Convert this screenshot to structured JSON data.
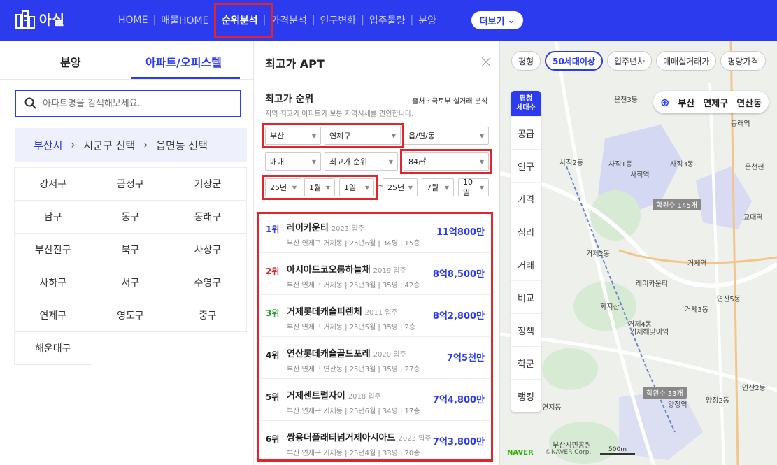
{
  "header": {
    "logo_text": "아실",
    "nav": [
      "HOME",
      "매물HOME",
      "순위분석",
      "가격분석",
      "인구변화",
      "입주물량",
      "분양"
    ],
    "active_index": 2,
    "more_label": "더보기"
  },
  "left": {
    "tabs": [
      "분양",
      "아파트/오피스텔"
    ],
    "active_tab": 1,
    "search_placeholder": "아파트명을 검색해보세요.",
    "breadcrumb": [
      "부산시",
      "시군구 선택",
      "읍면동 선택"
    ],
    "districts": [
      "강서구",
      "금정구",
      "기장군",
      "남구",
      "동구",
      "동래구",
      "부산진구",
      "북구",
      "사상구",
      "사하구",
      "서구",
      "수영구",
      "연제구",
      "영도구",
      "중구",
      "해운대구"
    ]
  },
  "middle": {
    "title": "최고가 APT",
    "rank_title": "최고가 순위",
    "source": "출처 : 국토부 실거래 분석",
    "desc": "지역 최고가 아파트가 보통 지역시세를 견인합니다.",
    "filters": {
      "city": "부산",
      "district": "연제구",
      "dong": "읍/면/동",
      "deal": "매매",
      "order": "최고가 순위",
      "area": "84㎡",
      "from_year": "25년",
      "from_month": "1월",
      "from_day": "1일",
      "dash": "~",
      "to_year": "25년",
      "to_month": "7월",
      "to_day": "10일"
    },
    "items": [
      {
        "rank": "1위",
        "name": "레이카운티",
        "year": "2023 입주",
        "meta": "부산 연제구 거제동 | 25년6월 | 34평 | 15층",
        "price": "11억800만",
        "color": "#2d3bef"
      },
      {
        "rank": "2위",
        "name": "아시아드코오롱하늘채",
        "year": "2019 입주",
        "meta": "부산 연제구 거제동 | 25년3월 | 35평 | 42층",
        "price": "8억8,500만",
        "color": "#e3242b"
      },
      {
        "rank": "3위",
        "name": "거제롯데캐슬피렌체",
        "year": "2011 입주",
        "meta": "부산 연제구 거제동 | 25년5월 | 35평 | 2층",
        "price": "8억2,800만",
        "color": "#2e9a3a"
      },
      {
        "rank": "4위",
        "name": "연산롯데캐슬골드포레",
        "year": "2020 입주",
        "meta": "부산 연제구 연산동 | 25년3월 | 35평 | 27층",
        "price": "7억5천만",
        "color": "#222222"
      },
      {
        "rank": "5위",
        "name": "거제센트럴자이",
        "year": "2018 입주",
        "meta": "부산 연제구 거제동 | 25년6월 | 34평 | 17층",
        "price": "7억4,800만",
        "color": "#222222"
      },
      {
        "rank": "6위",
        "name": "쌍용더플래티넘거제아시아드",
        "year": "2023 입주",
        "meta": "부산 연제구 거제동 | 25년4월 | 33평 | 20층",
        "price": "7억3,800만",
        "color": "#222222"
      }
    ]
  },
  "map": {
    "chips": [
      "평형",
      "50세대이상",
      "입주년차",
      "매매실거래가",
      "평당가격"
    ],
    "active_chip": 1,
    "side_top": [
      "평청",
      "세대수"
    ],
    "side_items": [
      "공급",
      "인구",
      "가격",
      "심리",
      "거래",
      "비교",
      "정책",
      "학군",
      "랭킹"
    ],
    "location": [
      "부산",
      "연제구",
      "연산동"
    ],
    "labels": [
      "온천3동",
      "사직1동",
      "사직2동",
      "사직3동",
      "사직역",
      "거제2동",
      "거제역",
      "레이카운티",
      "거제3동",
      "연산5동",
      "거제4동",
      "거제해맞이역",
      "연산2동",
      "양정2동",
      "양정역",
      "연지동",
      "온천천",
      "교대역",
      "동래역",
      "화지산",
      "부산시민공원"
    ],
    "counts": [
      "학원수 145개",
      "학원수 33개"
    ],
    "footer": {
      "brand": "NAVER",
      "copyright": "©NAVER Corp.",
      "scale": "500m"
    }
  }
}
